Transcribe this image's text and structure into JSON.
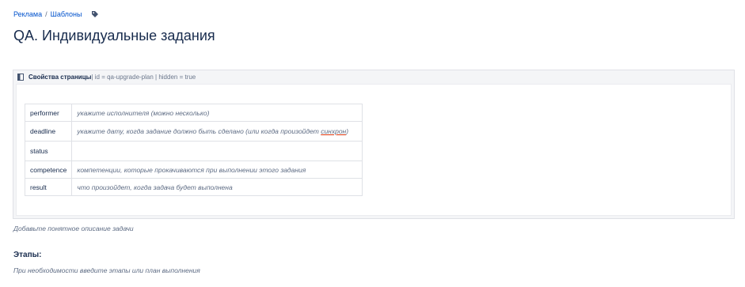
{
  "breadcrumbs": [
    "Реклама",
    "Шаблоны"
  ],
  "breadcrumb_separator": "/",
  "page_title": "QA. Индивидуальные задания",
  "page_properties": {
    "title": "Свойства страницы",
    "params": " | id = qa-upgrade-plan | hidden = true",
    "rows": [
      {
        "key": "performer",
        "value": "укажите исполнителя (можно несколько)"
      },
      {
        "key": "deadline",
        "value_prefix": "укажите дату, когда задание должно быть сделано (или когда произойдет ",
        "value_link": "синхрон",
        "value_suffix": ")"
      },
      {
        "key": "status",
        "value": ""
      },
      {
        "key": "competence",
        "value": "компетенции, которые прокачиваются при выполнении этого задания"
      },
      {
        "key": "result",
        "value": "что произойдет, когда задача будет выполнена"
      }
    ]
  },
  "description_hint": "Добавьте понятное описание задачи",
  "stages": {
    "heading": "Этапы:",
    "hint": "При необходимости введите этапы или план выполнения"
  },
  "icons": {
    "breadcrumb_tag": "tag-icon",
    "macro": "book-icon"
  },
  "colors": {
    "link": "#0052cc",
    "text": "#172b4d",
    "muted": "#5e6c84",
    "macro_bg": "#f4f5f7"
  }
}
